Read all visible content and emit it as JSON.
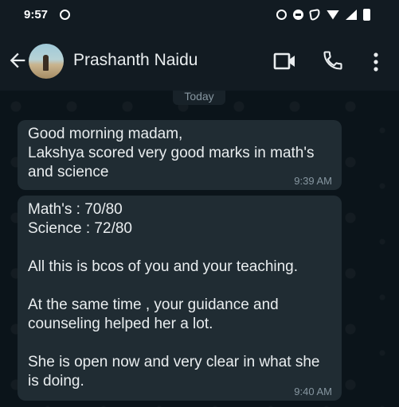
{
  "status_bar": {
    "time": "9:57"
  },
  "header": {
    "contact_name": "Prashanth Naidu"
  },
  "chat": {
    "date_label": "Today",
    "messages": [
      {
        "text": "Good morning madam,\nLakshya scored very good marks in math's and science",
        "time": "9:39 AM"
      },
      {
        "text": "Math's : 70/80\nScience : 72/80\n\nAll this is bcos of you and your teaching.\n\nAt the same time , your guidance and counseling helped her a lot.\n\nShe is open now and very clear in what she is doing.",
        "time": "9:40 AM"
      }
    ]
  },
  "colors": {
    "background": "#0b141a",
    "header": "#121b22",
    "bubble": "#202c33",
    "text": "#e9edef",
    "muted": "#8696a0"
  },
  "icons": [
    "back-arrow-icon",
    "video-call-icon",
    "phone-icon",
    "more-vert-icon"
  ]
}
